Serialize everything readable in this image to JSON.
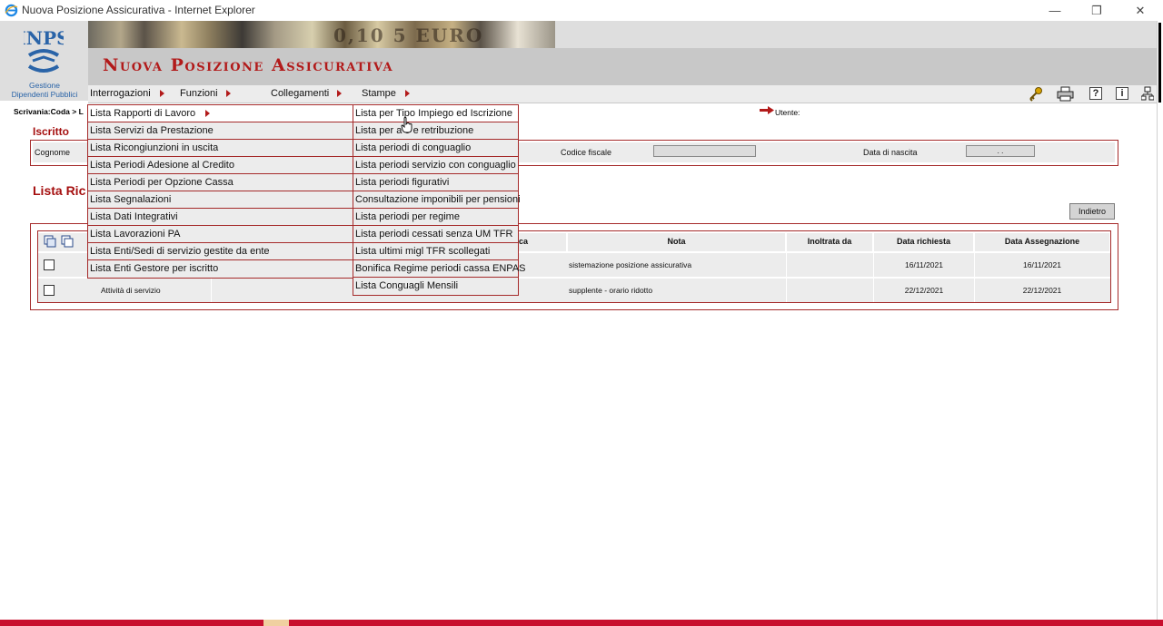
{
  "window": {
    "title": "Nuova Posizione Assicurativa - Internet Explorer",
    "minimize": "—",
    "restore": "❐",
    "close": "✕"
  },
  "header": {
    "logo_text": "INPS",
    "logo_caption_1": "Gestione",
    "logo_caption_2": "Dipendenti Pubblici",
    "banner_text": "0,10  5  EURO",
    "app_title": "Nuova Posizione Assicurativa"
  },
  "menubar": {
    "items": [
      {
        "label": "Interrogazioni"
      },
      {
        "label": "Funzioni"
      },
      {
        "label": "Collegamenti"
      },
      {
        "label": "Stampe"
      }
    ],
    "tools": [
      {
        "icon": "key-icon",
        "glyph": "⚿"
      },
      {
        "icon": "printer-icon",
        "glyph": "⎙"
      },
      {
        "icon": "help-icon",
        "glyph": "?"
      },
      {
        "icon": "info-icon",
        "glyph": "i"
      },
      {
        "icon": "network-icon",
        "glyph": "♜"
      }
    ]
  },
  "breadcrumb": "Scrivania:Coda > L",
  "user_label": "Utente:",
  "iscritto": {
    "title": "Iscritto",
    "cognome_label": "Cognome",
    "codice_fiscale_label": "Codice fiscale",
    "data_nascita_label": "Data di nascita",
    "data_nascita_value": ".  ."
  },
  "lista": {
    "title": "Lista Ric",
    "back_button": "Indietro",
    "columns": [
      "",
      "",
      "",
      "ca",
      "Nota",
      "Inoltrata da",
      "Data richiesta",
      "Data Assegnazione"
    ],
    "rows": [
      {
        "tipo": "",
        "nota": "sistemazione posizione assicurativa",
        "inoltrata_da": "",
        "data_richiesta": "16/11/2021",
        "data_assegnazione": "16/11/2021"
      },
      {
        "tipo": "Attività di servizio",
        "nota": "supplente - orario ridotto",
        "inoltrata_da": "",
        "data_richiesta": "22/12/2021",
        "data_assegnazione": "22/12/2021"
      }
    ]
  },
  "interrogazioni_menu": [
    "Lista Rapporti di Lavoro",
    "Lista Servizi da Prestazione",
    "Lista Ricongiunzioni in uscita",
    "Lista Periodi Adesione al Credito",
    "Lista Periodi per Opzione Cassa",
    "Lista Segnalazioni",
    "Lista Dati Integrativi",
    "Lista Lavorazioni PA",
    "Lista Enti/Sedi di servizio gestite da ente",
    "Lista Enti Gestore per iscritto"
  ],
  "rapporti_submenu": [
    "Lista per Tipo Impiego ed Iscrizione",
    "Lista per a   o e retribuzione",
    "Lista periodi di conguaglio",
    "Lista periodi servizio con conguaglio",
    "Lista periodi figurativi",
    "Consultazione imponibili per pensioni",
    "Lista periodi per regime",
    "Lista periodi cessati senza UM TFR",
    "Lista ultimi migl TFR scollegati",
    "Bonifica Regime periodi cassa ENPAS",
    "Lista Conguagli Mensili"
  ],
  "colors": {
    "brand_red": "#b21a1a",
    "border_red": "#a52a2a",
    "logo_blue": "#2a64a8"
  }
}
